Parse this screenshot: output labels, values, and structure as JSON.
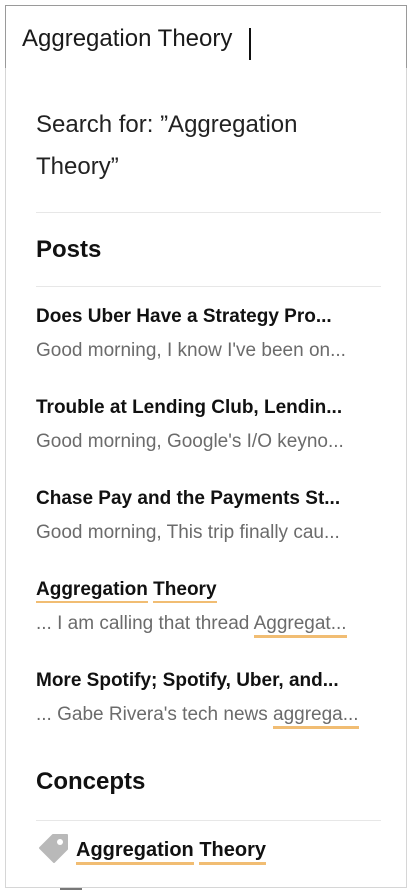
{
  "search": {
    "value": "Aggregation Theory"
  },
  "dropdown": {
    "search_for_label": "Search for:",
    "search_for_query": "”Aggregation Theory”",
    "posts_heading": "Posts",
    "posts": [
      {
        "title": "Does Uber Have a Strategy Pro...",
        "snippet": "Good morning, I know I've been on..."
      },
      {
        "title": "Trouble at Lending Club, Lendin...",
        "snippet": "Good morning, Google's I/O keyno..."
      },
      {
        "title": "Chase Pay and the Payments St...",
        "snippet": "Good morning, This trip finally cau..."
      },
      {
        "title_words": [
          "Aggregation",
          "Theory"
        ],
        "snippet_prefix": "... I am calling that thread",
        "snippet_highlight": "Aggregat..."
      },
      {
        "title": "More Spotify; Spotify, Uber, and...",
        "snippet_prefix": "... Gabe Rivera's tech news",
        "snippet_highlight": "aggrega..."
      }
    ],
    "concepts_heading": "Concepts",
    "concepts": [
      {
        "icon": "tag-icon",
        "words": [
          "Aggregation",
          "Theory"
        ]
      }
    ]
  },
  "colors": {
    "highlight": "#f1bd73",
    "snippet_text": "#6b6b6b",
    "tag_icon": "#b9b9b9"
  }
}
